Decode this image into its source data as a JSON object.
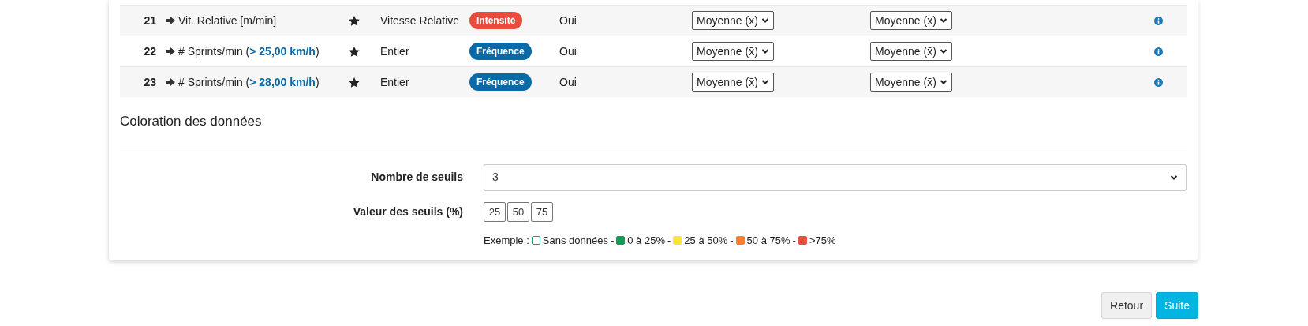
{
  "table": {
    "rows": [
      {
        "number": "21",
        "label": "Vit. Relative [m/min]",
        "starred": true,
        "type": "Vitesse Relative",
        "badge": {
          "text": "Intensité",
          "color": "#e74c3c"
        },
        "column_5": "Oui",
        "select_1": "Moyenne (x̄)",
        "select_2": "Moyenne (x̄)"
      },
      {
        "number": "22",
        "label": "# Sprints/min (",
        "highlight": "> 25,00 km/h",
        "label_end": ")",
        "starred": true,
        "type": "Entier",
        "badge": {
          "text": "Fréquence",
          "color": "#0a6aa8"
        },
        "column_5": "Oui",
        "select_1": "Moyenne (x̄)",
        "select_2": "Moyenne (x̄)"
      },
      {
        "number": "23",
        "label": "# Sprints/min (",
        "highlight": "> 28,00 km/h",
        "label_end": ")",
        "starred": true,
        "type": "Entier",
        "badge": {
          "text": "Fréquence",
          "color": "#0a6aa8"
        },
        "column_5": "Oui",
        "select_1": "Moyenne (x̄)",
        "select_2": "Moyenne (x̄)"
      }
    ]
  },
  "coloring": {
    "title": "Coloration des données",
    "threshold_count": {
      "label": "Nombre de seuils",
      "value": "3"
    },
    "threshold_values": {
      "label": "Valeur des seuils (%)",
      "values": [
        "25",
        "50",
        "75"
      ]
    },
    "example": {
      "label": "Exemple :",
      "items": [
        {
          "text": "Sans données",
          "color": "#1aa36f",
          "filled": false,
          "separator": "-"
        },
        {
          "text": "0 à 25%",
          "color": "#0f9d58",
          "filled": true,
          "separator": "-"
        },
        {
          "text": "25 à 50%",
          "color": "#fbe53b",
          "filled": true,
          "separator": "-"
        },
        {
          "text": "50 à 75%",
          "color": "#fd7e2c",
          "filled": true,
          "separator": "-"
        },
        {
          "text": ">75%",
          "color": "#e74c3c",
          "filled": true
        }
      ]
    }
  },
  "buttons": [
    {
      "text": "Retour",
      "kind": "secondary"
    },
    {
      "text": "Suite",
      "kind": "primary"
    }
  ]
}
